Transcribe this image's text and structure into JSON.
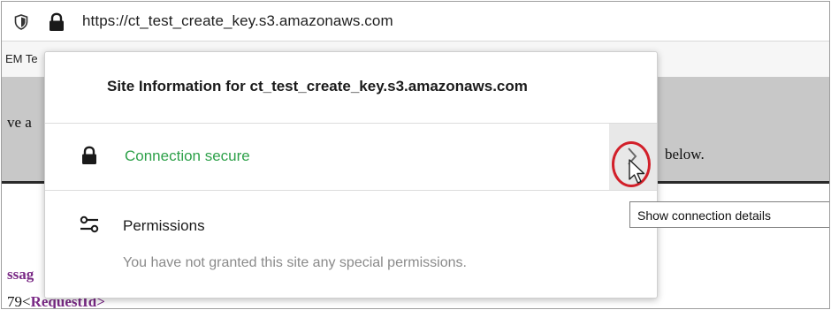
{
  "urlbar": {
    "url": "https://ct_test_create_key.s3.amazonaws.com",
    "shield_icon": "shield-icon",
    "lock_icon": "lock-icon"
  },
  "background_page": {
    "bookmark_fragment": "EM Te",
    "band_left_fragment": "ve a",
    "band_right_fragment": "below.",
    "message_fragment": "ssag",
    "request_fragment_prefix": "79<",
    "request_fragment_tag": "RequestId>"
  },
  "site_info_panel": {
    "title": "Site Information for ct_test_create_key.s3.amazonaws.com",
    "connection": {
      "icon": "lock-icon",
      "label": "Connection secure",
      "label_color": "#2ea14a",
      "details_button_icon": "chevron-right-icon"
    },
    "permissions": {
      "icon": "permissions-icon",
      "title": "Permissions",
      "description": "You have not granted this site any special permissions."
    }
  },
  "tooltip": {
    "text": "Show connection details"
  },
  "annotation": {
    "highlight_color": "#d2202a"
  }
}
